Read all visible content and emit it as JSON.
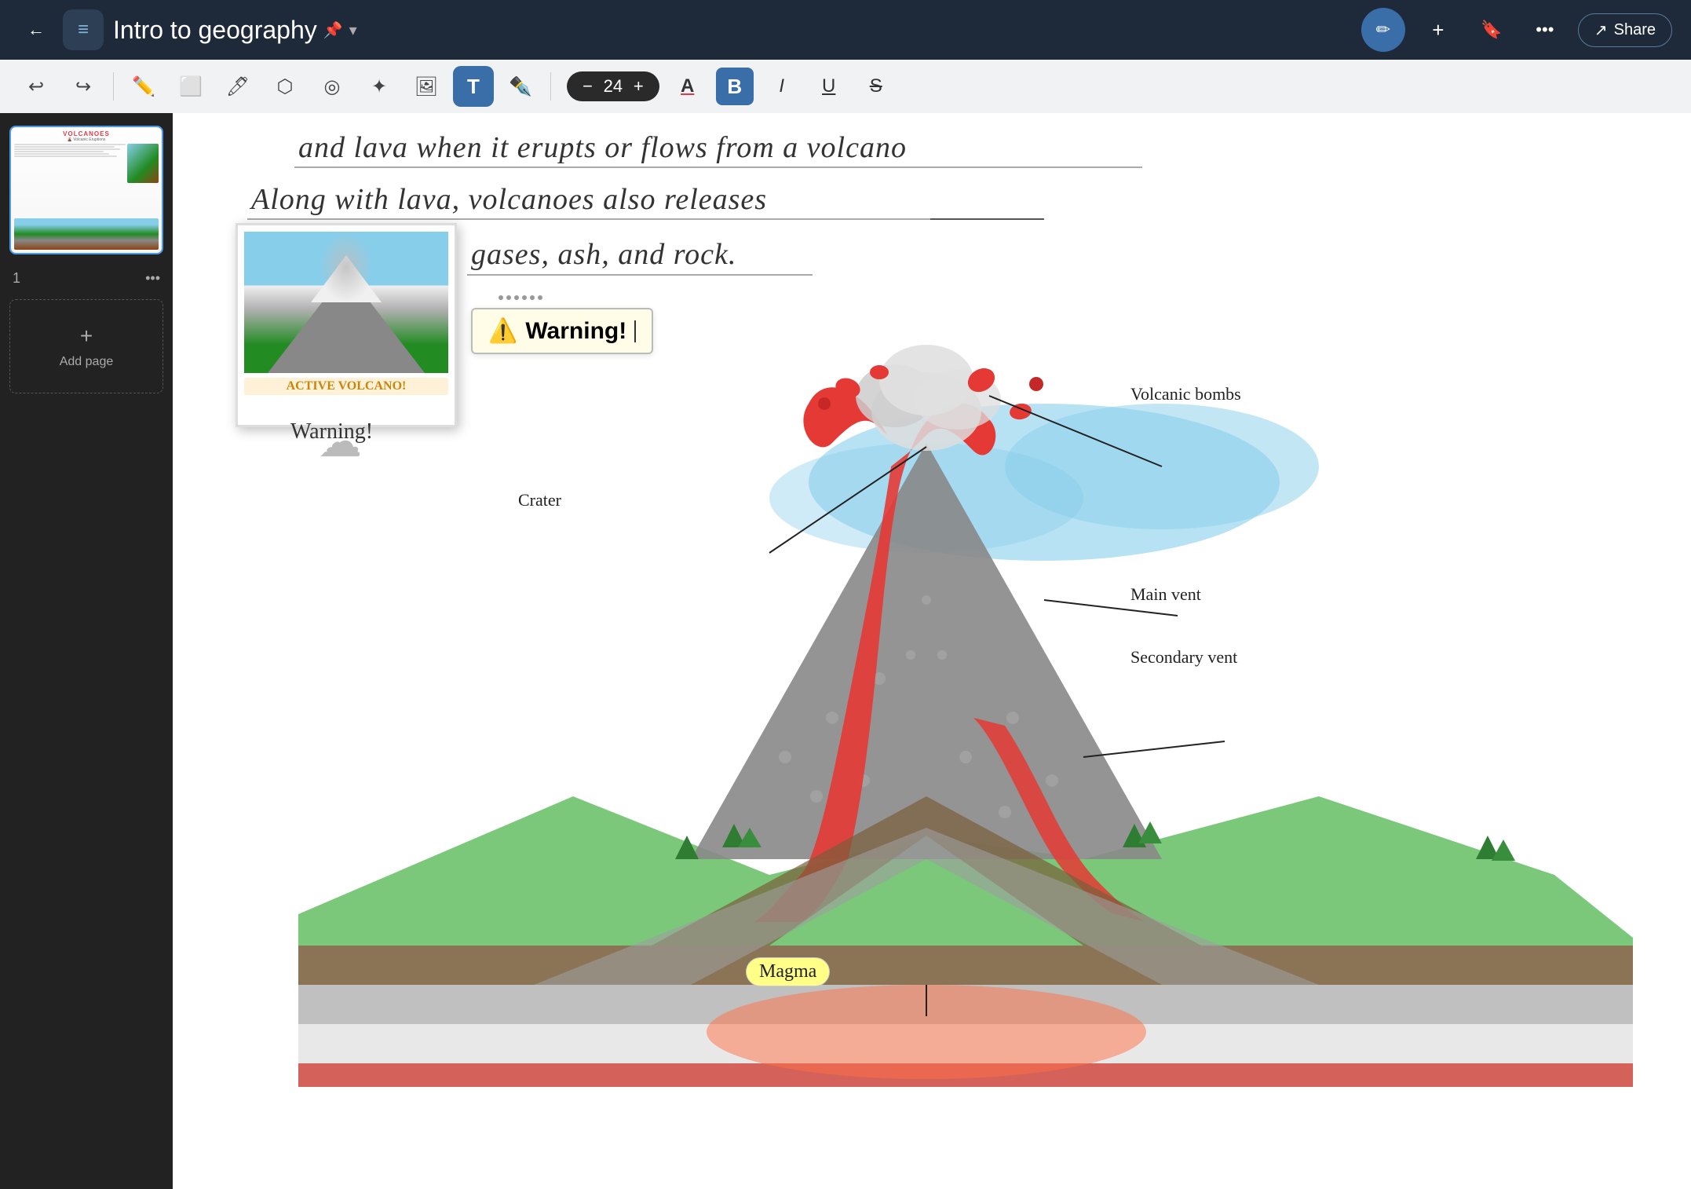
{
  "header": {
    "back_label": "←",
    "notebook_icon": "≡",
    "title": "Intro to geography",
    "title_pin": "📌",
    "pencil_icon": "✏",
    "add_icon": "+",
    "bookmark_icon": "🔖",
    "more_icon": "•••",
    "share_icon": "↗",
    "share_label": "Share"
  },
  "toolbar": {
    "undo_icon": "↩",
    "redo_icon": "↪",
    "pen_icon": "✏",
    "eraser_icon": "◻",
    "marker_icon": "〄",
    "lasso_icon": "⬡",
    "shape_icon": "◎",
    "star_icon": "✦",
    "image_icon": "🖼",
    "text_icon": "T",
    "pencil2_icon": "✒",
    "minus_icon": "−",
    "font_size": "24",
    "plus_icon": "+",
    "font_color_icon": "A",
    "bold_icon": "B",
    "italic_icon": "I",
    "underline_icon": "U",
    "strikethrough_icon": "S"
  },
  "sidebar": {
    "page_number": "1",
    "more_icon": "•••",
    "add_page_label": "Add page",
    "add_icon": "+"
  },
  "canvas": {
    "line1": "and lava  when it erupts or flows from a volcano",
    "line2": "Along with lava, volcanoes also releases",
    "line3": "gases, ash, and rock.",
    "warning_label": "⚠️  Warning!",
    "photo_caption": "ACTIVE VOLCANO!",
    "warning_below": "Warning!",
    "labels": {
      "volcanic_bombs": "Volcanic bombs",
      "crater": "Crater",
      "main_vent": "Main vent",
      "secondary_vent": "Secondary vent",
      "magma": "Magma"
    }
  }
}
